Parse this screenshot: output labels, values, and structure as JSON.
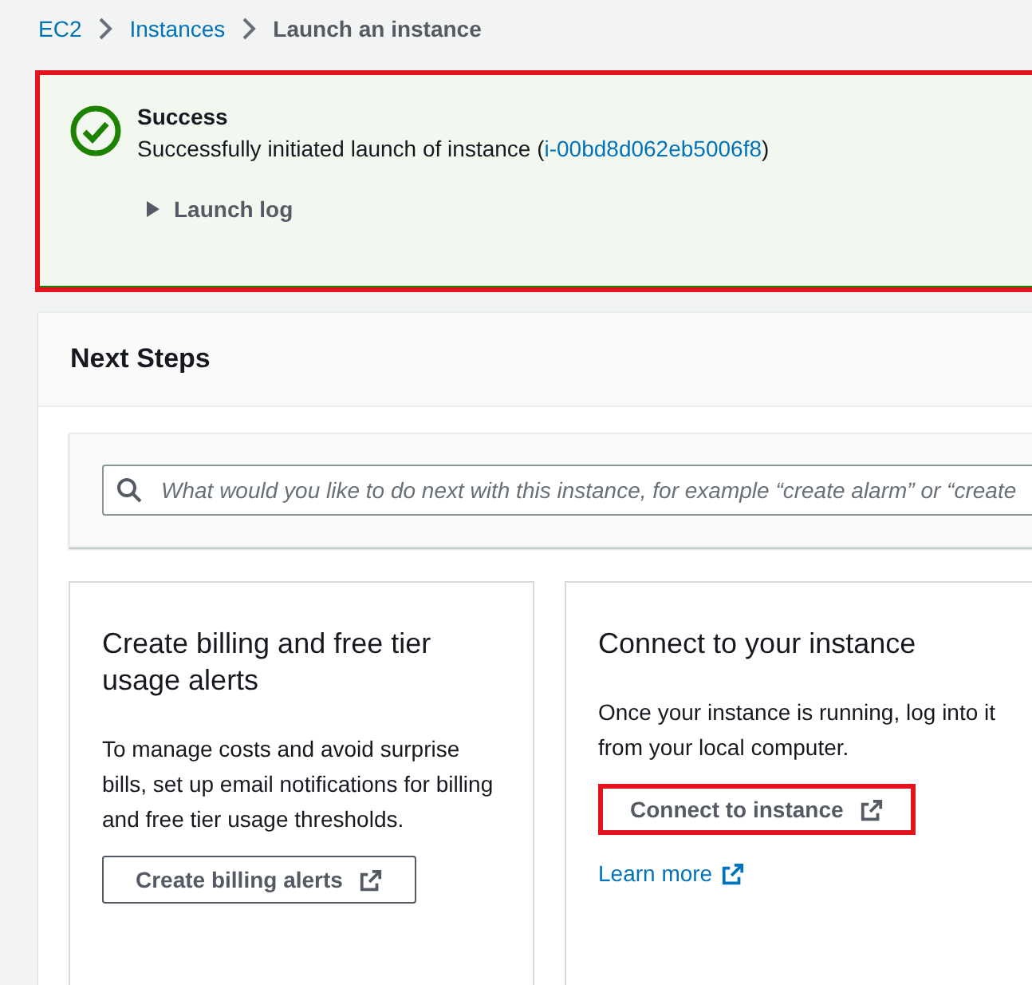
{
  "breadcrumb": [
    {
      "label": "EC2",
      "kind": "link"
    },
    {
      "label": "Instances",
      "kind": "link"
    },
    {
      "label": "Launch an instance",
      "kind": "current"
    }
  ],
  "alert": {
    "kind": "success",
    "highlighted": true,
    "title": "Success",
    "message": "Successfully initiated launch of instance (",
    "instance_id": "i-00bd8d062eb5006f8",
    "message_end": ")",
    "log_toggle": {
      "label": "Launch log",
      "expanded": false
    }
  },
  "next_steps": {
    "title": "Next Steps",
    "search": {
      "placeholder": "What would you like to do next with this instance, for example “create alarm” or “create"
    },
    "cards": [
      {
        "title": "Create billing and free tier usage alerts",
        "text": "To manage costs and avoid surprise bills, set up email notifications for billing and free tier usage thresholds.",
        "button": {
          "label": "Create billing alerts",
          "highlighted": false
        }
      },
      {
        "title": "Connect to your instance",
        "text": "Once your instance is running, log into it from your local computer.",
        "button": {
          "label": "Connect to instance",
          "highlighted": true
        },
        "link": "Learn more"
      }
    ]
  }
}
